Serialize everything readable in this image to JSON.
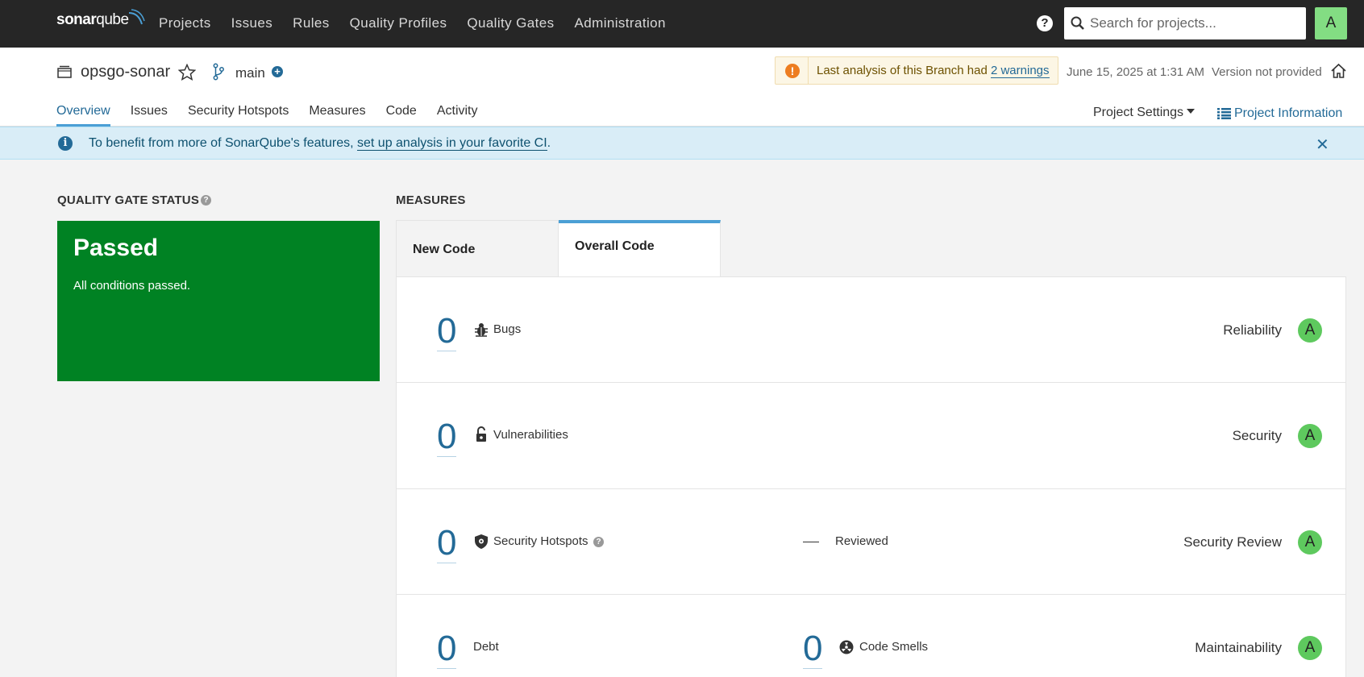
{
  "nav": {
    "logo_bold": "sonar",
    "logo_light": "qube",
    "links": [
      "Projects",
      "Issues",
      "Rules",
      "Quality Profiles",
      "Quality Gates",
      "Administration"
    ],
    "help_label": "?",
    "search_placeholder": "Search for projects...",
    "avatar": "A"
  },
  "project": {
    "name": "opsgo-sonar",
    "branch": "main",
    "warning_prefix": "Last analysis of this Branch had ",
    "warning_link": "2 warnings",
    "analysis_date": "June 15, 2025 at 1:31 AM",
    "version": "Version not provided",
    "tabs": [
      "Overview",
      "Issues",
      "Security Hotspots",
      "Measures",
      "Code",
      "Activity"
    ],
    "settings_label": "Project Settings",
    "info_label": "Project Information"
  },
  "banner": {
    "text": "To benefit from more of SonarQube's features, ",
    "link": "set up analysis in your favorite CI",
    "suffix": ".",
    "close": "✕"
  },
  "quality_gate": {
    "title": "QUALITY GATE STATUS",
    "status": "Passed",
    "description": "All conditions passed.",
    "status_color": "#008223"
  },
  "measures": {
    "title": "MEASURES",
    "tabs": {
      "new": "New Code",
      "overall": "Overall Code"
    },
    "rows": {
      "bugs": {
        "value": "0",
        "label": "Bugs",
        "rating_label": "Reliability",
        "rating": "A"
      },
      "vulnerabilities": {
        "value": "0",
        "label": "Vulnerabilities",
        "rating_label": "Security",
        "rating": "A"
      },
      "hotspots": {
        "value": "0",
        "label": "Security Hotspots",
        "reviewed_label": "Reviewed",
        "rating_label": "Security Review",
        "rating": "A"
      },
      "debt": {
        "value": "0",
        "label": "Debt",
        "smells_value": "0",
        "smells_label": "Code Smells",
        "rating_label": "Maintainability",
        "rating": "A"
      }
    },
    "rating_color": "#5ec95e"
  }
}
